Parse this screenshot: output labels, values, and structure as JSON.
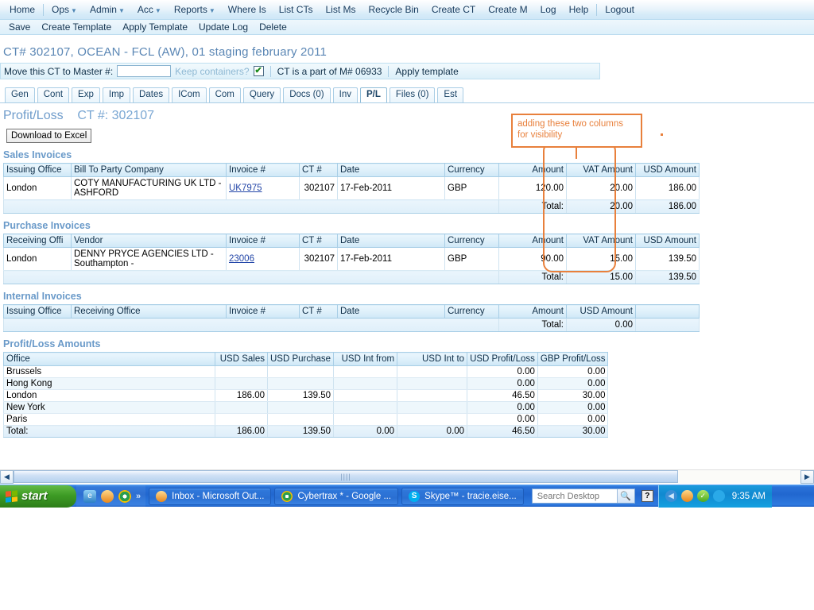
{
  "topnav": {
    "items": [
      {
        "label": "Home",
        "caret": false
      },
      {
        "label": "Ops",
        "caret": true
      },
      {
        "label": "Admin",
        "caret": true
      },
      {
        "label": "Acc",
        "caret": true
      },
      {
        "label": "Reports",
        "caret": true
      },
      {
        "label": "Where Is",
        "caret": false
      },
      {
        "label": "List CTs",
        "caret": false
      },
      {
        "label": "List Ms",
        "caret": false
      },
      {
        "label": "Recycle Bin",
        "caret": false
      },
      {
        "label": "Create CT",
        "caret": false
      },
      {
        "label": "Create M",
        "caret": false
      },
      {
        "label": "Log",
        "caret": false
      },
      {
        "label": "Help",
        "caret": false
      },
      {
        "label": "Logout",
        "caret": false
      }
    ]
  },
  "subnav": {
    "items": [
      "Save",
      "Create Template",
      "Apply Template",
      "Update Log",
      "Delete"
    ]
  },
  "page": {
    "title": "CT# 302107, OCEAN - FCL (AW), 01 staging february 2011",
    "heading_main": "Profit/Loss",
    "heading_ct": "CT #: 302107",
    "download_button": "Download to Excel"
  },
  "movebar": {
    "label": "Move this CT to Master #:",
    "input_value": "",
    "input_placeholder": "",
    "keep_containers_label": "Keep containers?",
    "keep_containers_checked": "✔",
    "part_of_text": "CT is a part of M# 06933",
    "apply_template": "Apply template"
  },
  "tabs": [
    {
      "label": "Gen",
      "active": false
    },
    {
      "label": "Cont",
      "active": false
    },
    {
      "label": "Exp",
      "active": false
    },
    {
      "label": "Imp",
      "active": false
    },
    {
      "label": "Dates",
      "active": false
    },
    {
      "label": "ICom",
      "active": false
    },
    {
      "label": "Com",
      "active": false
    },
    {
      "label": "Query",
      "active": false
    },
    {
      "label": "Docs (0)",
      "active": false
    },
    {
      "label": "Inv",
      "active": false
    },
    {
      "label": "P/L",
      "active": true
    },
    {
      "label": "Files (0)",
      "active": false
    },
    {
      "label": "Est",
      "active": false
    }
  ],
  "annotation": {
    "text": "adding these two columns for visibility",
    "color": "#e8803c"
  },
  "sales_invoices": {
    "section_title": "Sales Invoices",
    "headers": [
      "Issuing Office",
      "Bill To Party Company",
      "Invoice #",
      "CT #",
      "Date",
      "Currency",
      "Amount",
      "VAT Amount",
      "USD Amount"
    ],
    "rows": [
      {
        "issuing_office": "London",
        "bill_to": "COTY MANUFACTURING UK LTD - ASHFORD",
        "invoice": "UK7975",
        "ct": "302107",
        "date": "17-Feb-2011",
        "currency": "GBP",
        "amount": "120.00",
        "vat": "20.00",
        "usd": "186.00"
      }
    ],
    "total_label": "Total:",
    "total_vat": "20.00",
    "total_usd": "186.00"
  },
  "purchase_invoices": {
    "section_title": "Purchase Invoices",
    "headers": [
      "Receiving Offi",
      "Vendor",
      "Invoice #",
      "CT #",
      "Date",
      "Currency",
      "Amount",
      "VAT Amount",
      "USD Amount"
    ],
    "rows": [
      {
        "receiving_office": "London",
        "vendor": "DENNY PRYCE AGENCIES LTD - Southampton -",
        "invoice": "23006",
        "ct": "302107",
        "date": "17-Feb-2011",
        "currency": "GBP",
        "amount": "90.00",
        "vat": "15.00",
        "usd": "139.50"
      }
    ],
    "total_label": "Total:",
    "total_vat": "15.00",
    "total_usd": "139.50"
  },
  "internal_invoices": {
    "section_title": "Internal Invoices",
    "headers": [
      "Issuing Office",
      "Receiving Office",
      "Invoice #",
      "CT #",
      "Date",
      "Currency",
      "Amount",
      "USD Amount"
    ],
    "total_label": "Total:",
    "total_usd": "0.00"
  },
  "profit_loss": {
    "section_title": "Profit/Loss Amounts",
    "headers": [
      "Office",
      "USD Sales",
      "USD Purchase",
      "USD Int from",
      "USD Int to",
      "USD Profit/Loss",
      "GBP Profit/Loss"
    ],
    "rows": [
      {
        "office": "Brussels",
        "usd_sales": "",
        "usd_purchase": "",
        "usd_int_from": "",
        "usd_int_to": "",
        "usd_pl": "0.00",
        "gbp_pl": "0.00"
      },
      {
        "office": "Hong Kong",
        "usd_sales": "",
        "usd_purchase": "",
        "usd_int_from": "",
        "usd_int_to": "",
        "usd_pl": "0.00",
        "gbp_pl": "0.00"
      },
      {
        "office": "London",
        "usd_sales": "186.00",
        "usd_purchase": "139.50",
        "usd_int_from": "",
        "usd_int_to": "",
        "usd_pl": "46.50",
        "gbp_pl": "30.00"
      },
      {
        "office": "New York",
        "usd_sales": "",
        "usd_purchase": "",
        "usd_int_from": "",
        "usd_int_to": "",
        "usd_pl": "0.00",
        "gbp_pl": "0.00"
      },
      {
        "office": "Paris",
        "usd_sales": "",
        "usd_purchase": "",
        "usd_int_from": "",
        "usd_int_to": "",
        "usd_pl": "0.00",
        "gbp_pl": "0.00"
      }
    ],
    "total": {
      "office": "Total:",
      "usd_sales": "186.00",
      "usd_purchase": "139.50",
      "usd_int_from": "0.00",
      "usd_int_to": "0.00",
      "usd_pl": "46.50",
      "gbp_pl": "30.00"
    }
  },
  "scrollbar": {
    "left_arrow": "◀",
    "right_arrow": "▶",
    "grip": "||||"
  },
  "taskbar": {
    "start_label": "start",
    "quick_launch_more": "»",
    "buttons": [
      {
        "label": "Inbox - Microsoft Out...",
        "icon": "outlook-icon",
        "glyph": "◔"
      },
      {
        "label": "Cybertrax * - Google ...",
        "icon": "chrome-icon",
        "glyph": ""
      },
      {
        "label": "Skype™ - tracie.eise...",
        "icon": "skype-icon",
        "glyph": "S"
      }
    ],
    "search_placeholder": "Search Desktop",
    "search_value": "",
    "help_glyph": "?",
    "clock": "9:35 AM"
  }
}
